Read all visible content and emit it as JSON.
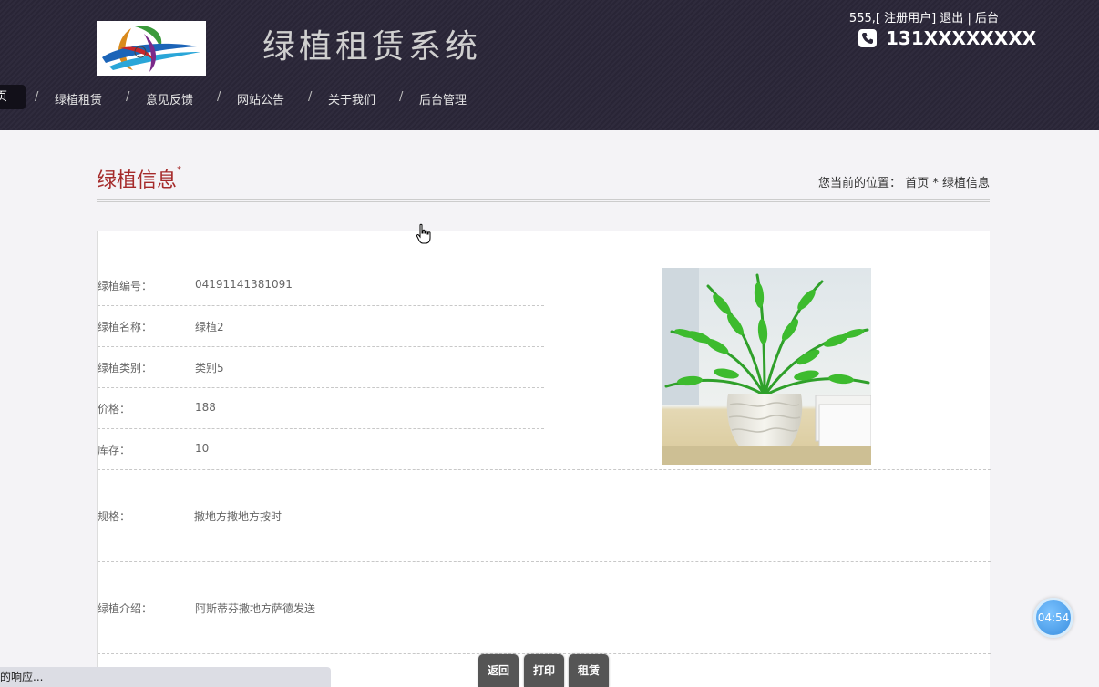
{
  "header": {
    "site_title": "绿植租赁系统",
    "user_text": "555,[ 注册用户]",
    "logout": "退出",
    "divider": "|",
    "admin": "后台",
    "phone": "131XXXXXXXX"
  },
  "nav": {
    "active_label": "首页",
    "items": [
      "绿植租赁",
      "意见反馈",
      "网站公告",
      "关于我们",
      "后台管理"
    ],
    "separator": "/"
  },
  "page": {
    "title": "绿植信息",
    "title_mark": "*",
    "breadcrumb_prefix": "您当前的位置：",
    "breadcrumb_home": "首页",
    "breadcrumb_sep": "*",
    "breadcrumb_current": "绿植信息"
  },
  "details": {
    "fields": [
      {
        "label": "绿植编号：",
        "value": "04191141381091"
      },
      {
        "label": "绿植名称：",
        "value": "绿植2"
      },
      {
        "label": "绿植类别：",
        "value": "类别5"
      },
      {
        "label": "价格：",
        "value": "188"
      },
      {
        "label": "库存：",
        "value": "10"
      }
    ],
    "spec_label": "规格：",
    "spec_value": "撒地方撒地方按时",
    "intro_label": "绿植介绍：",
    "intro_value": "阿斯蒂芬撒地方萨德发送"
  },
  "buttons": {
    "back": "返回",
    "print": "打印",
    "rent": "租赁"
  },
  "timer": "04:54",
  "status_bar": "的响应..."
}
